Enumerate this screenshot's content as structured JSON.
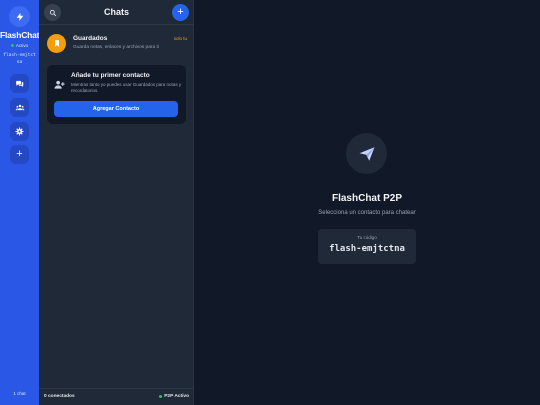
{
  "rail": {
    "brand": "FlashChat",
    "status": "Activo",
    "user_code": "flash-emjtctna",
    "footer": "1 chat",
    "buttons": [
      {
        "icon": "chat-bubbles-icon"
      },
      {
        "icon": "group-icon"
      },
      {
        "icon": "gear-icon"
      },
      {
        "icon": "plus-icon",
        "label": "+"
      }
    ]
  },
  "panel": {
    "title": "Chats",
    "add_label": "+",
    "saved": {
      "name": "Guardados",
      "badge": "solo tu",
      "subtitle": "Guarda notas, enlaces y archivos para ti"
    },
    "card": {
      "title": "Añade tu primer contacto",
      "subtitle": "Mientras tanto yo puedes usar Guardados para notas y recordatorios.",
      "button": "Agregar Contacto"
    },
    "footer": {
      "connected": "0 conectados",
      "status": "P2P Activo"
    }
  },
  "main": {
    "title": "FlashChat P2P",
    "subtitle": "Selecciona un contacto para chatear",
    "code_label": "Tu código",
    "code_value": "flash-emjtctna"
  },
  "colors": {
    "rail": "#2b57e6",
    "accent": "#2563eb",
    "saved": "#f59e0b",
    "online": "#22c55e",
    "background": "#111827",
    "panel": "#1f2937"
  }
}
